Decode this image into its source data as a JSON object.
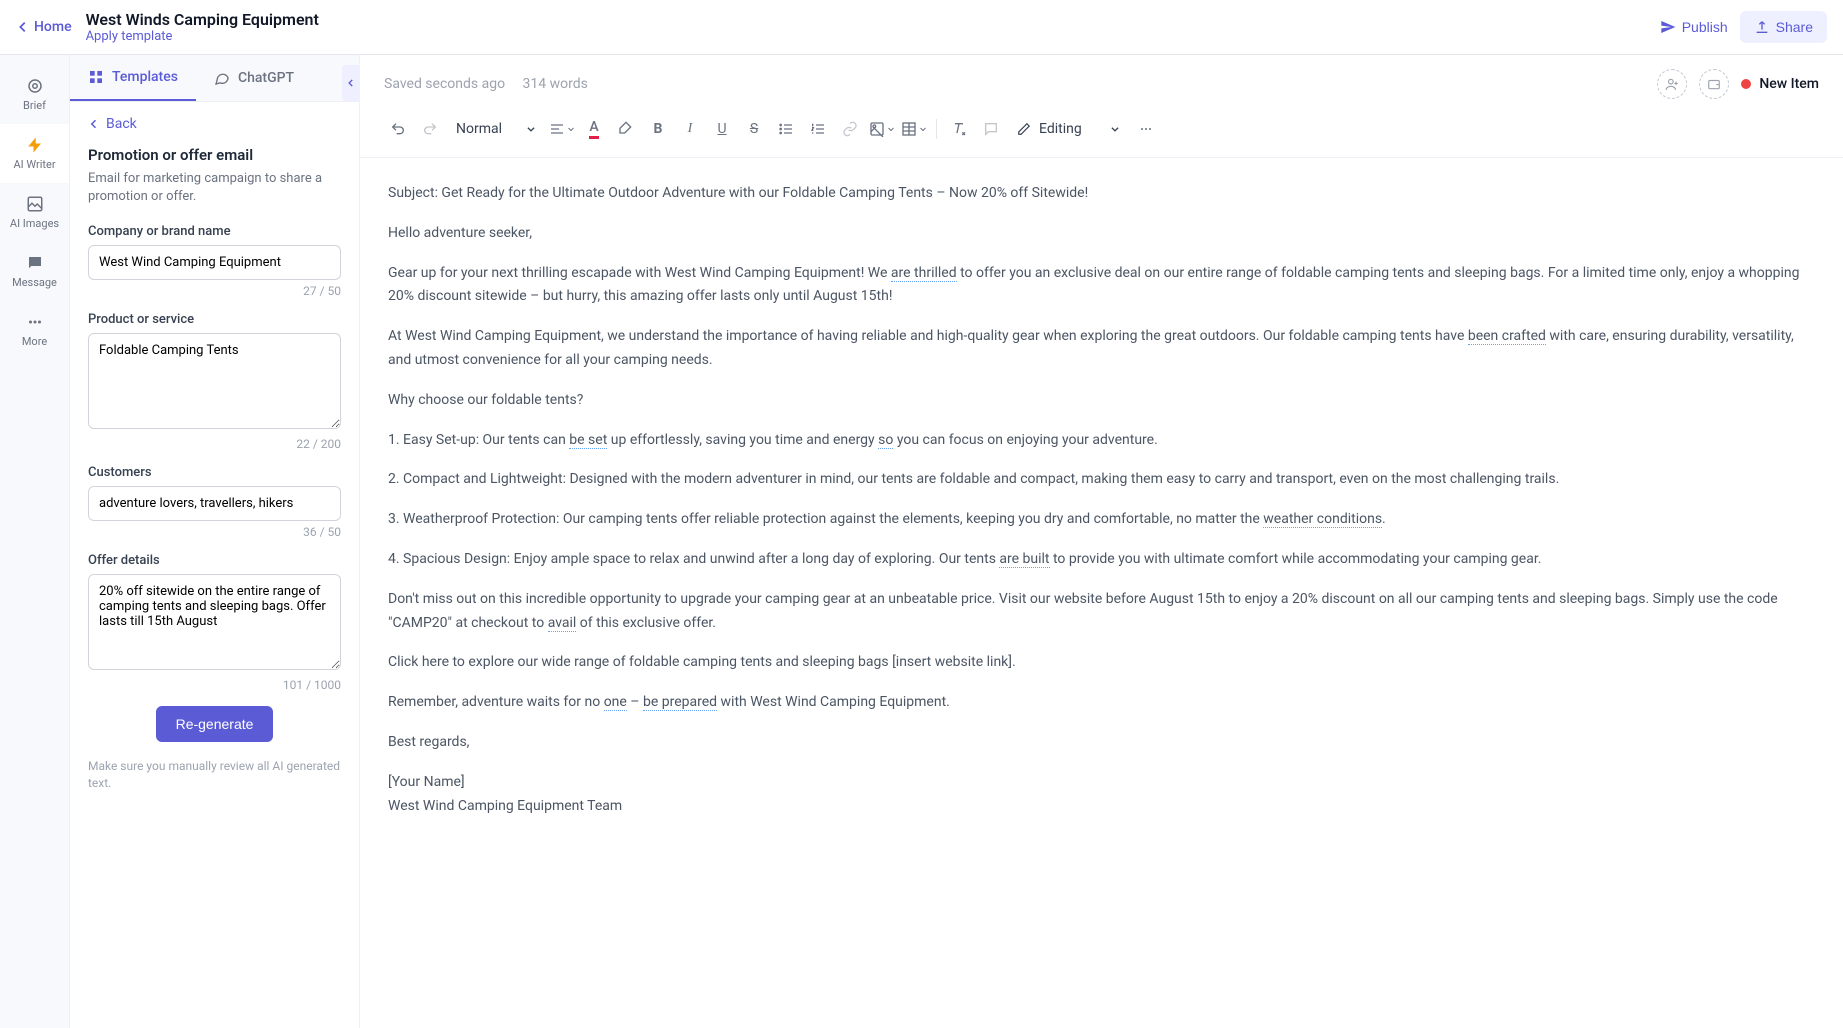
{
  "header": {
    "home": "Home",
    "title": "West Winds Camping Equipment",
    "apply_template": "Apply template",
    "publish": "Publish",
    "share": "Share"
  },
  "rail": {
    "brief": "Brief",
    "ai_writer": "AI Writer",
    "ai_images": "AI Images",
    "message": "Message",
    "more": "More"
  },
  "tabs": {
    "templates": "Templates",
    "chatgpt": "ChatGPT"
  },
  "panel": {
    "back": "Back",
    "title": "Promotion or offer email",
    "desc": "Email for marketing campaign to share a promotion or offer.",
    "company_label": "Company or brand name",
    "company_value": "West Wind Camping Equipment",
    "company_counter": "27 / 50",
    "product_label": "Product or service",
    "product_value": "Foldable Camping Tents",
    "product_counter": "22 / 200",
    "customers_label": "Customers",
    "customers_value": "adventure lovers, travellers, hikers",
    "customers_counter": "36 / 50",
    "offer_label": "Offer details",
    "offer_value": "20% off sitewide on the entire range of camping tents and sleeping bags. Offer lasts till 15th August",
    "offer_counter": "101 / 1000",
    "regenerate": "Re-generate",
    "note": "Make sure you manually review all AI generated text."
  },
  "editor_meta": {
    "saved": "Saved seconds ago",
    "words": "314 words",
    "new_item": "New Item"
  },
  "toolbar": {
    "normal": "Normal",
    "editing": "Editing"
  },
  "doc": {
    "p1a": "Subject: Get Ready for the Ultimate Outdoor Adventure with our Foldable Camping Tents – Now 20% off Sitewide!",
    "p2": "Hello adventure seeker,",
    "p3a": "Gear up for your next thrilling escapade with West Wind Camping Equipment! We ",
    "p3b": "are thrilled",
    "p3c": " to offer you an exclusive deal on our entire range of foldable camping tents and sleeping bags. For a limited time only, enjoy a whopping 20% discount sitewide – but hurry, this amazing offer lasts only until August 15th!",
    "p4a": "At West Wind Camping Equipment, we understand the importance of having reliable and high-quality gear when exploring the great outdoors. Our foldable camping tents have ",
    "p4b": "been crafted",
    "p4c": " with care, ensuring durability, versatility, and utmost convenience for all your camping needs.",
    "p5": "Why choose our foldable tents?",
    "p6a": "1. Easy Set-up: Our tents can ",
    "p6b": "be set",
    "p6c": " up effortlessly, saving you time and energy ",
    "p6d": "so",
    "p6e": " you can focus on enjoying your adventure.",
    "p7": "2. Compact and Lightweight: Designed with the modern adventurer in mind, our tents are foldable and compact, making them easy to carry and transport, even on the most challenging trails.",
    "p8a": "3. Weatherproof Protection: Our camping tents offer reliable protection against the elements, keeping you dry and comfortable, no matter the ",
    "p8b": "weather conditions",
    "p8c": ".",
    "p9a": "4. Spacious Design: Enjoy ample space to relax and unwind after a long day of exploring. Our tents ",
    "p9b": "are built",
    "p9c": " to provide you with ultimate comfort while accommodating your camping gear.",
    "p10a": "Don't miss out on this incredible opportunity to upgrade your camping gear at an unbeatable price. Visit our website before August 15th to enjoy a 20% discount on all our camping tents and sleeping bags. Simply use the code \"CAMP20\" at checkout to ",
    "p10b": "avail",
    "p10c": " of this exclusive offer.",
    "p11": "Click here to explore our wide range of foldable camping tents and sleeping bags [insert website link].",
    "p12a": "Remember, adventure waits for no ",
    "p12b": "one",
    "p12c": " – ",
    "p12d": "be prepared",
    "p12e": " with West Wind Camping Equipment.",
    "p13": "Best regards,",
    "p14": "[Your Name]",
    "p15": "West Wind Camping Equipment Team"
  }
}
